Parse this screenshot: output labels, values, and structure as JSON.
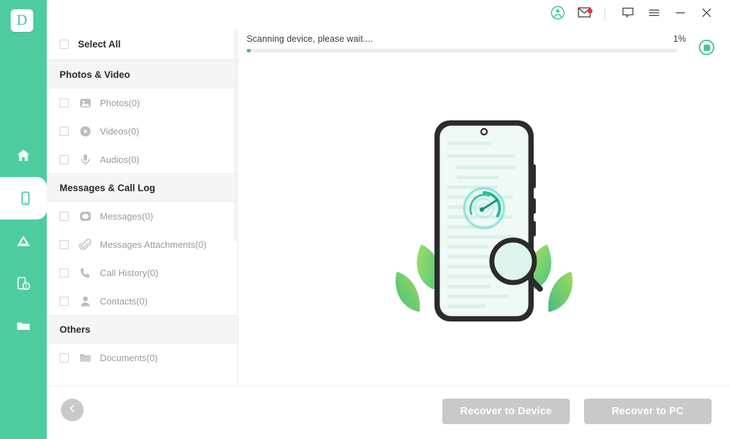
{
  "app": {
    "logo_letter": "D",
    "accent_color": "#4ECCA0",
    "accent_dark": "#3FBF8F",
    "disabled_color": "#C9C9C9",
    "notification_color": "#FF2D2D"
  },
  "rail": {
    "items": [
      {
        "name": "home",
        "icon": "home-icon",
        "active": false
      },
      {
        "name": "phone-recovery",
        "icon": "phone-icon",
        "active": true
      },
      {
        "name": "cloud-recovery",
        "icon": "cloud-icon",
        "active": false
      },
      {
        "name": "system-repair",
        "icon": "phone-repair-icon",
        "active": false
      },
      {
        "name": "files",
        "icon": "folder-icon",
        "active": false
      }
    ]
  },
  "titlebar": {
    "icons": [
      {
        "name": "account-icon",
        "label": "Account"
      },
      {
        "name": "mail-icon",
        "label": "Messages",
        "badge": true
      },
      {
        "name": "feedback-icon",
        "label": "Feedback"
      },
      {
        "name": "menu-icon",
        "label": "Menu"
      },
      {
        "name": "minimize-icon",
        "label": "Minimize"
      },
      {
        "name": "close-icon",
        "label": "Close"
      }
    ]
  },
  "progress": {
    "status_text": "Scanning device, please wait....",
    "percent_label": "1%",
    "percent_value": 1,
    "stop_button_label": "Stop"
  },
  "sidebar": {
    "select_all_label": "Select All",
    "sections": [
      {
        "title": "Photos & Video",
        "items": [
          {
            "label": "Photos(0)",
            "icon": "photo-icon",
            "count": 0
          },
          {
            "label": "Videos(0)",
            "icon": "video-icon",
            "count": 0
          },
          {
            "label": "Audios(0)",
            "icon": "audio-icon",
            "count": 0
          }
        ]
      },
      {
        "title": "Messages & Call Log",
        "items": [
          {
            "label": "Messages(0)",
            "icon": "message-icon",
            "count": 0
          },
          {
            "label": "Messages Attachments(0)",
            "icon": "attachment-icon",
            "count": 0
          },
          {
            "label": "Call History(0)",
            "icon": "phone-call-icon",
            "count": 0
          },
          {
            "label": "Contacts(0)",
            "icon": "contact-icon",
            "count": 0
          }
        ]
      },
      {
        "title": "Others",
        "items": [
          {
            "label": "Documents(0)",
            "icon": "document-folder-icon",
            "count": 0
          }
        ]
      }
    ]
  },
  "stage": {
    "illustration": "phone-scanning-magnifier-leaves"
  },
  "footer": {
    "back_label": "Back",
    "recover_to_device_label": "Recover to Device",
    "recover_to_pc_label": "Recover to PC"
  }
}
